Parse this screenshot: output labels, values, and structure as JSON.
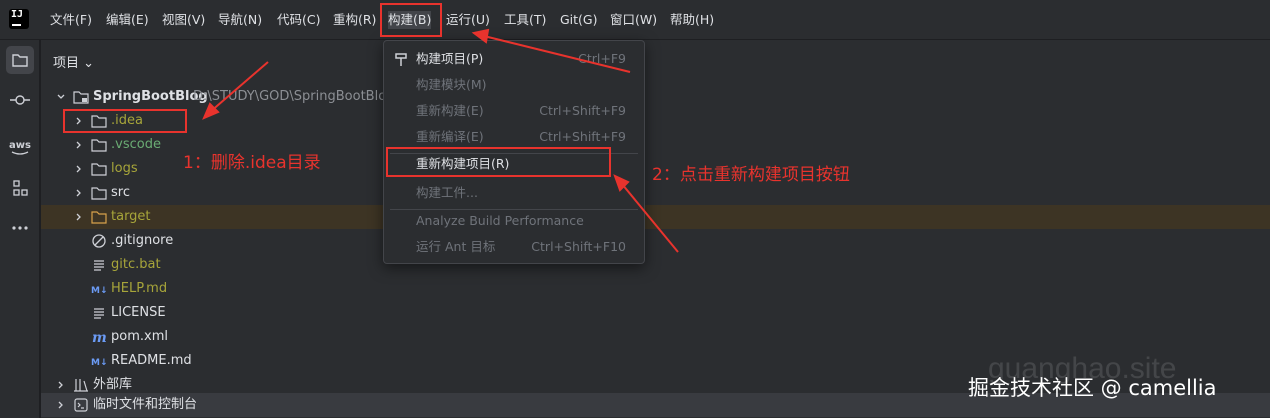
{
  "app": {
    "logo": "IJ"
  },
  "menubar": {
    "items": [
      "文件(F)",
      "编辑(E)",
      "视图(V)",
      "导航(N)",
      "代码(C)",
      "重构(R)",
      "构建(B)",
      "运行(U)",
      "工具(T)",
      "Git(G)",
      "窗口(W)",
      "帮助(H)"
    ]
  },
  "toolstrip": {
    "aws_label": "aws"
  },
  "project_panel": {
    "title": "项目 ⌄",
    "root": {
      "name": "SpringBootBlog",
      "path": "D:\\STUDY\\GOD\\SpringBootBlog"
    },
    "items": [
      {
        "name": ".idea",
        "icon": "folder-icon",
        "expandable": true
      },
      {
        "name": ".vscode",
        "icon": "folder-icon",
        "expandable": true
      },
      {
        "name": "logs",
        "icon": "folder-icon",
        "expandable": true
      },
      {
        "name": "src",
        "icon": "folder-icon",
        "expandable": true
      },
      {
        "name": "target",
        "icon": "folder-icon",
        "expandable": true
      },
      {
        "name": ".gitignore",
        "icon": "ignore-file-icon",
        "expandable": false
      },
      {
        "name": "gitc.bat",
        "icon": "text-file-icon",
        "expandable": false
      },
      {
        "name": "HELP.md",
        "icon": "markdown-icon",
        "expandable": false
      },
      {
        "name": "LICENSE",
        "icon": "text-file-icon",
        "expandable": false
      },
      {
        "name": "pom.xml",
        "icon": "maven-icon",
        "expandable": false
      },
      {
        "name": "README.md",
        "icon": "markdown-icon",
        "expandable": false
      }
    ],
    "external_libs": "外部库",
    "scratches": "临时文件和控制台"
  },
  "build_menu": {
    "items": [
      {
        "label": "构建项目(P)",
        "shortcut": "Ctrl+F9",
        "enabled": true
      },
      {
        "label": "构建模块(M)",
        "shortcut": "",
        "enabled": false
      },
      {
        "label": "重新构建(E)",
        "shortcut": "Ctrl+Shift+F9",
        "enabled": false
      },
      {
        "label": "重新编译(E)",
        "shortcut": "Ctrl+Shift+F9",
        "enabled": false
      },
      {
        "label": "重新构建项目(R)",
        "shortcut": "",
        "enabled": true
      },
      {
        "label": "构建工件...",
        "shortcut": "",
        "enabled": false
      },
      {
        "label": "Analyze Build Performance",
        "shortcut": "",
        "enabled": false
      },
      {
        "label": "运行 Ant 目标",
        "shortcut": "Ctrl+Shift+F10",
        "enabled": false
      }
    ]
  },
  "annotations": {
    "step1": "1：删除.idea目录",
    "step2": "2：点击重新构建项目按钮",
    "accent_color": "#e8332d"
  },
  "watermark": "掘金技术社区 @ camellia",
  "watermark_ghost": "guanghao.site"
}
